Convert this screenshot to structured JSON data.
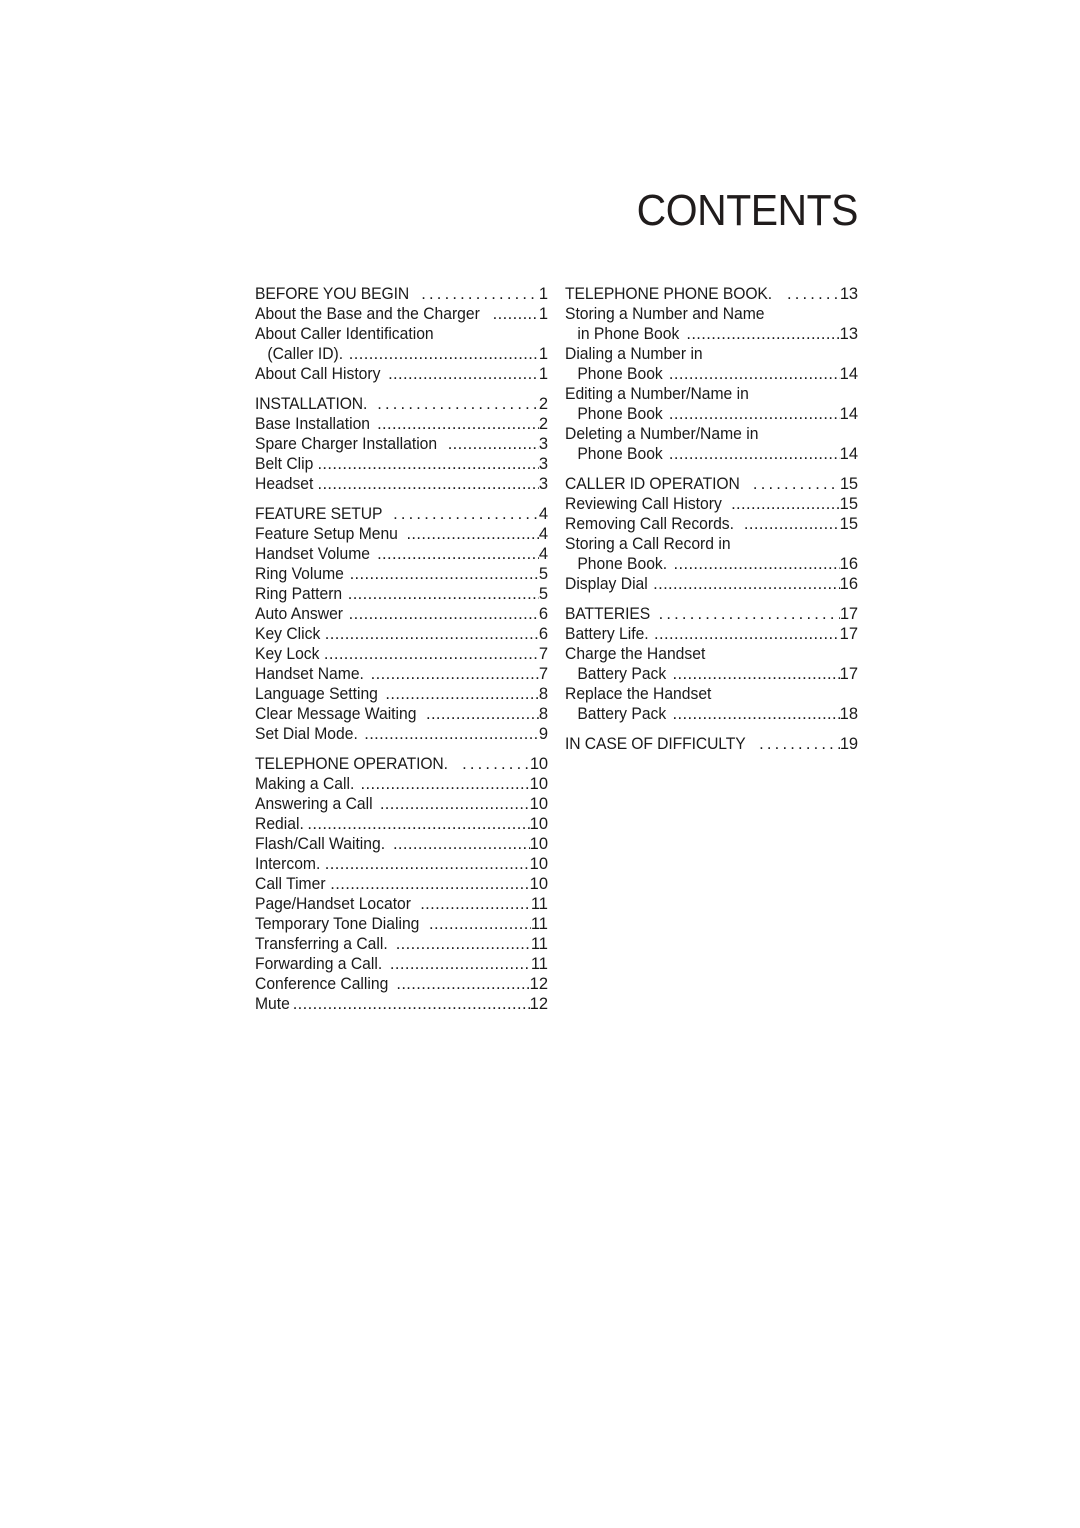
{
  "document": {
    "title": "CONTENTS"
  },
  "toc": {
    "left_column": [
      {
        "label": "BEFORE YOU BEGIN",
        "page": "1",
        "style": "heading",
        "indent": false,
        "leader": true,
        "gap_before": false
      },
      {
        "label": "About the Base and the Charger",
        "page": "1",
        "style": "entry",
        "indent": false,
        "leader": true,
        "gap_before": false
      },
      {
        "label": "About Caller Identification",
        "page": "",
        "style": "entry",
        "indent": false,
        "leader": false,
        "gap_before": false
      },
      {
        "label": "(Caller ID).",
        "page": "1",
        "style": "entry",
        "indent": true,
        "leader": true,
        "gap_before": false
      },
      {
        "label": "About Call History",
        "page": "1",
        "style": "entry",
        "indent": false,
        "leader": true,
        "gap_before": false
      },
      {
        "label": "INSTALLATION.",
        "page": "2",
        "style": "heading",
        "indent": false,
        "leader": true,
        "gap_before": true
      },
      {
        "label": "Base Installation",
        "page": "2",
        "style": "entry",
        "indent": false,
        "leader": true,
        "gap_before": false
      },
      {
        "label": "Spare Charger Installation",
        "page": "3",
        "style": "entry",
        "indent": false,
        "leader": true,
        "gap_before": false
      },
      {
        "label": "Belt Clip",
        "page": "3",
        "style": "entry",
        "indent": false,
        "leader": true,
        "gap_before": false
      },
      {
        "label": "Headset",
        "page": "3",
        "style": "entry",
        "indent": false,
        "leader": true,
        "gap_before": false
      },
      {
        "label": "FEATURE SETUP",
        "page": "4",
        "style": "heading",
        "indent": false,
        "leader": true,
        "gap_before": true
      },
      {
        "label": "Feature Setup Menu",
        "page": "4",
        "style": "entry",
        "indent": false,
        "leader": true,
        "gap_before": false
      },
      {
        "label": "Handset Volume",
        "page": "4",
        "style": "entry",
        "indent": false,
        "leader": true,
        "gap_before": false
      },
      {
        "label": "Ring Volume",
        "page": "5",
        "style": "entry",
        "indent": false,
        "leader": true,
        "gap_before": false
      },
      {
        "label": "Ring Pattern",
        "page": "5",
        "style": "entry",
        "indent": false,
        "leader": true,
        "gap_before": false
      },
      {
        "label": "Auto Answer",
        "page": "6",
        "style": "entry",
        "indent": false,
        "leader": true,
        "gap_before": false
      },
      {
        "label": "Key Click",
        "page": "6",
        "style": "entry",
        "indent": false,
        "leader": true,
        "gap_before": false
      },
      {
        "label": "Key Lock",
        "page": "7",
        "style": "entry",
        "indent": false,
        "leader": true,
        "gap_before": false
      },
      {
        "label": "Handset Name.",
        "page": "7",
        "style": "entry",
        "indent": false,
        "leader": true,
        "gap_before": false
      },
      {
        "label": "Language Setting",
        "page": "8",
        "style": "entry",
        "indent": false,
        "leader": true,
        "gap_before": false
      },
      {
        "label": "Clear Message Waiting",
        "page": "8",
        "style": "entry",
        "indent": false,
        "leader": true,
        "gap_before": false
      },
      {
        "label": "Set Dial Mode.",
        "page": "9",
        "style": "entry",
        "indent": false,
        "leader": true,
        "gap_before": false
      },
      {
        "label": "TELEPHONE OPERATION.",
        "page": "10",
        "style": "heading",
        "indent": false,
        "leader": true,
        "gap_before": true
      },
      {
        "label": "Making a Call.",
        "page": "10",
        "style": "entry",
        "indent": false,
        "leader": true,
        "gap_before": false
      },
      {
        "label": "Answering a Call",
        "page": "10",
        "style": "entry",
        "indent": false,
        "leader": true,
        "gap_before": false
      },
      {
        "label": "Redial.",
        "page": "10",
        "style": "entry",
        "indent": false,
        "leader": true,
        "gap_before": false
      },
      {
        "label": "Flash/Call Waiting.",
        "page": "10",
        "style": "entry",
        "indent": false,
        "leader": true,
        "gap_before": false
      },
      {
        "label": "Intercom.",
        "page": "10",
        "style": "entry",
        "indent": false,
        "leader": true,
        "gap_before": false
      },
      {
        "label": "Call Timer",
        "page": "10",
        "style": "entry",
        "indent": false,
        "leader": true,
        "gap_before": false
      },
      {
        "label": "Page/Handset Locator",
        "page": "11",
        "style": "entry",
        "indent": false,
        "leader": true,
        "gap_before": false
      },
      {
        "label": "Temporary Tone Dialing",
        "page": "11",
        "style": "entry",
        "indent": false,
        "leader": true,
        "gap_before": false
      },
      {
        "label": "Transferring a Call.",
        "page": "11",
        "style": "entry",
        "indent": false,
        "leader": true,
        "gap_before": false
      },
      {
        "label": "Forwarding a Call.",
        "page": "11",
        "style": "entry",
        "indent": false,
        "leader": true,
        "gap_before": false
      },
      {
        "label": "Conference Calling",
        "page": "12",
        "style": "entry",
        "indent": false,
        "leader": true,
        "gap_before": false
      },
      {
        "label": "Mute",
        "page": "12",
        "style": "entry",
        "indent": false,
        "leader": true,
        "gap_before": false
      }
    ],
    "right_column": [
      {
        "label": "TELEPHONE PHONE BOOK.",
        "page": "13",
        "style": "heading",
        "indent": false,
        "leader": true,
        "gap_before": false
      },
      {
        "label": "Storing a Number and Name",
        "page": "",
        "style": "entry",
        "indent": false,
        "leader": false,
        "gap_before": false
      },
      {
        "label": "in Phone Book",
        "page": "13",
        "style": "entry",
        "indent": true,
        "leader": true,
        "gap_before": false
      },
      {
        "label": "Dialing a Number in",
        "page": "",
        "style": "entry",
        "indent": false,
        "leader": false,
        "gap_before": false
      },
      {
        "label": "Phone Book",
        "page": "14",
        "style": "entry",
        "indent": true,
        "leader": true,
        "gap_before": false
      },
      {
        "label": "Editing a Number/Name in",
        "page": "",
        "style": "entry",
        "indent": false,
        "leader": false,
        "gap_before": false
      },
      {
        "label": "Phone Book",
        "page": "14",
        "style": "entry",
        "indent": true,
        "leader": true,
        "gap_before": false
      },
      {
        "label": "Deleting a Number/Name in",
        "page": "",
        "style": "entry",
        "indent": false,
        "leader": false,
        "gap_before": false
      },
      {
        "label": "Phone Book",
        "page": "14",
        "style": "entry",
        "indent": true,
        "leader": true,
        "gap_before": false
      },
      {
        "label": "CALLER ID OPERATION",
        "page": "15",
        "style": "heading",
        "indent": false,
        "leader": true,
        "gap_before": true
      },
      {
        "label": "Reviewing Call History",
        "page": "15",
        "style": "entry",
        "indent": false,
        "leader": true,
        "gap_before": false
      },
      {
        "label": "Removing Call Records.",
        "page": "15",
        "style": "entry",
        "indent": false,
        "leader": true,
        "gap_before": false
      },
      {
        "label": "Storing a Call Record in",
        "page": "",
        "style": "entry",
        "indent": false,
        "leader": false,
        "gap_before": false
      },
      {
        "label": "Phone Book.",
        "page": "16",
        "style": "entry",
        "indent": true,
        "leader": true,
        "gap_before": false
      },
      {
        "label": "Display Dial",
        "page": "16",
        "style": "entry",
        "indent": false,
        "leader": true,
        "gap_before": false
      },
      {
        "label": "BATTERIES",
        "page": "17",
        "style": "heading",
        "indent": false,
        "leader": true,
        "gap_before": true
      },
      {
        "label": "Battery Life.",
        "page": "17",
        "style": "entry",
        "indent": false,
        "leader": true,
        "gap_before": false
      },
      {
        "label": "Charge the Handset",
        "page": "",
        "style": "entry",
        "indent": false,
        "leader": false,
        "gap_before": false
      },
      {
        "label": "Battery Pack",
        "page": "17",
        "style": "entry",
        "indent": true,
        "leader": true,
        "gap_before": false
      },
      {
        "label": "Replace the Handset",
        "page": "",
        "style": "entry",
        "indent": false,
        "leader": false,
        "gap_before": false
      },
      {
        "label": "Battery Pack",
        "page": "18",
        "style": "entry",
        "indent": true,
        "leader": true,
        "gap_before": false
      },
      {
        "label": "IN CASE OF DIFFICULTY",
        "page": "19",
        "style": "heading",
        "indent": false,
        "leader": true,
        "gap_before": true
      }
    ]
  }
}
